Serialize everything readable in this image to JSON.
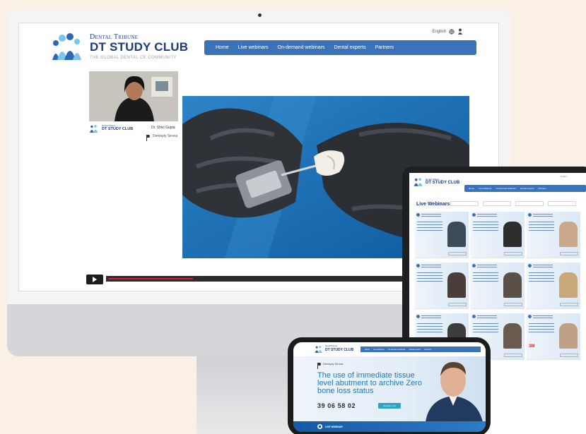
{
  "site": {
    "publisher": "Dental Tribune",
    "title": "DT STUDY CLUB",
    "tagline": "THE GLOBAL DENTAL CE COMMUNITY"
  },
  "utility": {
    "language": "English"
  },
  "nav": [
    "Home",
    "Live webinars",
    "On-demand webinars",
    "Dental experts",
    "Partners"
  ],
  "presenter": {
    "name": "Dr. Shivi Gupta",
    "sponsor": "Dentsply Sirona"
  },
  "player": {
    "progress_pct": 22
  },
  "tablet": {
    "page_title": "Live Webinars",
    "cards": [
      {
        "brand": "",
        "photo": "#3b4b5a"
      },
      {
        "brand": "",
        "photo": "#2d2d2d"
      },
      {
        "brand": "",
        "photo": "#c9a98a"
      },
      {
        "brand": "",
        "photo": "#4a3d3a"
      },
      {
        "brand": "",
        "photo": "#5b5048"
      },
      {
        "brand": "",
        "photo": "#c8a878"
      },
      {
        "brand": "",
        "photo": "#3d3c3a"
      },
      {
        "brand": "",
        "photo": "#6a5a4e"
      },
      {
        "brand": "3M",
        "photo": "#bfa286"
      }
    ]
  },
  "phone": {
    "sponsor": "Dentsply Sirona",
    "headline": "The use of immediate tissue level abutment to archive Zero bone loss status",
    "countdown": "39 06 58 02",
    "register_label": "Register now",
    "footer_label": "LIVE WEBINAR"
  }
}
